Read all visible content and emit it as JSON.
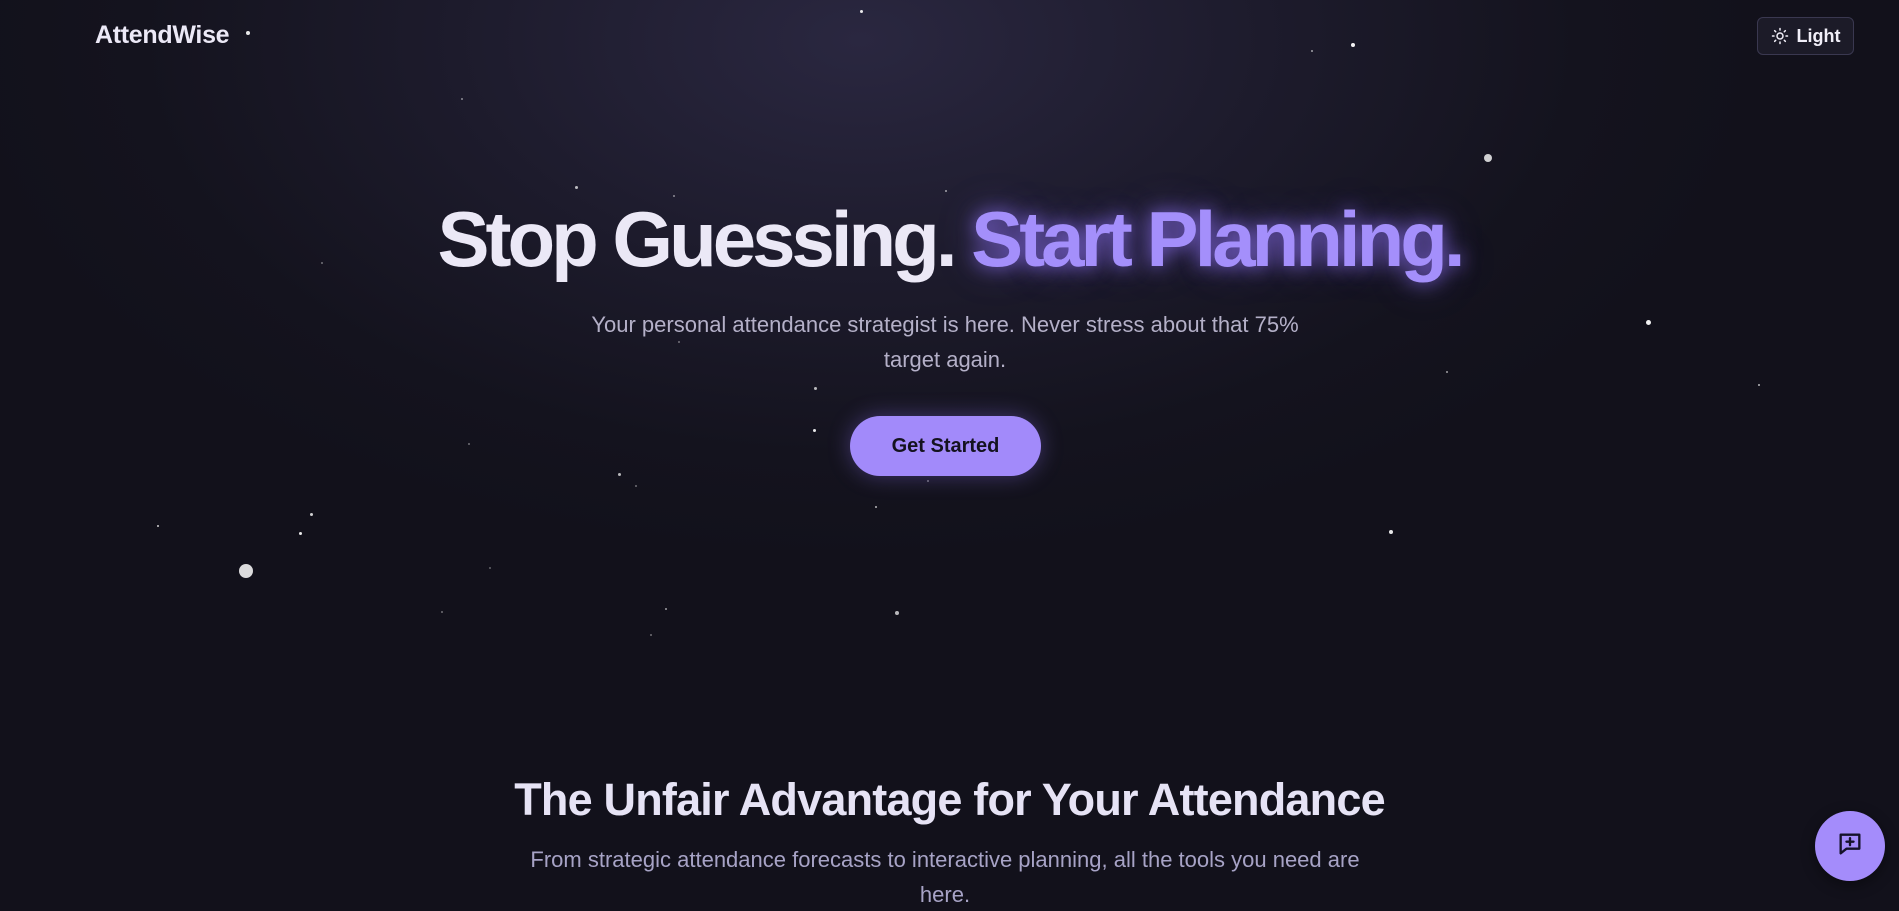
{
  "header": {
    "brand": "AttendWise",
    "theme_toggle_label": "Light",
    "theme_icon": "sun-icon"
  },
  "hero": {
    "title_part1": "Stop Guessing.",
    "title_part2": "Start Planning.",
    "subtitle": "Your personal attendance strategist is here. Never stress about that 75% target again.",
    "cta_label": "Get Started"
  },
  "features": {
    "title": "The Unfair Advantage for Your Attendance",
    "subtitle": "From strategic attendance forecasts to interactive planning, all the tools you need are here."
  },
  "chat_button": {
    "icon": "chat-plus-icon"
  },
  "colors": {
    "background": "#12111c",
    "accent": "#a48ffb",
    "text_primary": "#ebe8f6",
    "text_secondary": "#b4b0c8"
  }
}
